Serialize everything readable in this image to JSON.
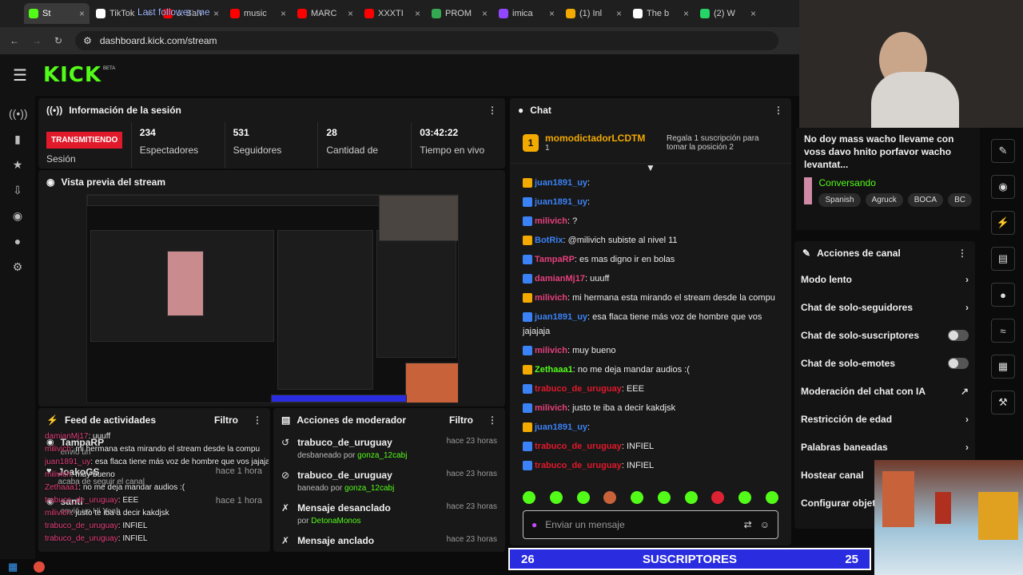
{
  "browser": {
    "tabs": [
      {
        "label": "St",
        "color": "#53fc18",
        "active": true
      },
      {
        "label": "TikTok",
        "color": "#ffffff"
      },
      {
        "label": "J. Balv",
        "color": "#ff0000"
      },
      {
        "label": "music",
        "color": "#ff0000"
      },
      {
        "label": "MARC",
        "color": "#ff0000"
      },
      {
        "label": "XXXTI",
        "color": "#ff0000"
      },
      {
        "label": "PROM",
        "color": "#34a853"
      },
      {
        "label": "imica",
        "color": "#9146ff"
      },
      {
        "label": "(1) Inl",
        "color": "#f2a900"
      },
      {
        "label": "The b",
        "color": "#ffffff"
      },
      {
        "label": "(2) W",
        "color": "#25d366"
      }
    ],
    "tab_overlay": "Last follower: me",
    "url": "dashboard.kick.com/stream"
  },
  "kick": {
    "logo": "KICK",
    "beta": "BETA"
  },
  "session": {
    "title": "Información de la sesión",
    "status": "TRANSMITIENDO",
    "status_label": "Sesión",
    "stats": [
      {
        "value": "234",
        "label": "Espectadores"
      },
      {
        "value": "531",
        "label": "Seguidores"
      },
      {
        "value": "28",
        "label": "Cantidad de"
      },
      {
        "value": "03:42:22",
        "label": "Tiempo en vivo"
      }
    ]
  },
  "preview": {
    "title": "Vista previa del stream"
  },
  "feed": {
    "title": "Feed de actividades",
    "filter": "Filtro",
    "items": [
      {
        "user": "TampaRP",
        "action": "envió un",
        "time": ""
      },
      {
        "user": "JoakoGS",
        "action": "acaba de seguir el canal",
        "time": "hace 1 hora"
      },
      {
        "user": "santi",
        "action": "envió un Hi Yeah",
        "time": "hace 1 hora"
      }
    ],
    "overlay_lines": [
      {
        "user": "damianMj17",
        "text": "uuuff"
      },
      {
        "user": "milivich",
        "text": "mi hermana esta mirando el stream desde la compu"
      },
      {
        "user": "juan1891_uy",
        "text": "esa flaca tiene más voz de hombre que vos jajajaja"
      },
      {
        "user": "milivich",
        "text": "muy bueno"
      },
      {
        "user": "Zethaaa1",
        "text": "no me deja mandar audios :("
      },
      {
        "user": "trabuco_de_uruguay",
        "text": "EEE"
      },
      {
        "user": "milivich",
        "text": "justo te iba a decir kakdjsk"
      },
      {
        "user": "trabuco_de_uruguay",
        "text": "INFIEL"
      },
      {
        "user": "trabuco_de_uruguay",
        "text": "INFIEL"
      }
    ]
  },
  "mod": {
    "title": "Acciones de moderador",
    "filter": "Filtro",
    "items": [
      {
        "title": "trabuco_de_uruguay",
        "sub": "desbaneado por",
        "by": "gonza_12cabj",
        "time": "hace 23 horas"
      },
      {
        "title": "trabuco_de_uruguay",
        "sub": "baneado por",
        "by": "gonza_12cabj",
        "time": "hace 23 horas"
      },
      {
        "title": "Mensaje desanclado",
        "sub": "por",
        "by": "DetonaMonos",
        "time": "hace 23 horas"
      },
      {
        "title": "Mensaje anclado",
        "sub": "",
        "by": "",
        "time": "hace 23 horas"
      }
    ]
  },
  "chat": {
    "title": "Chat",
    "pinned_user": "momodictadorLCDTM",
    "pinned_rank": "1",
    "pinned_count": "1",
    "pinned_cta": "Regala 1 suscripción para tomar la posición 2",
    "messages": [
      {
        "user": "juan1891_uy",
        "color": "#3b82f6",
        "text": ""
      },
      {
        "user": "juan1891_uy",
        "color": "#3b82f6",
        "text": ""
      },
      {
        "user": "milivich",
        "color": "#e4407b",
        "text": "?"
      },
      {
        "user": "BotRix",
        "color": "#3b82f6",
        "text": "@milivich subiste al nivel 11"
      },
      {
        "user": "TampaRP",
        "color": "#e4407b",
        "text": "es mas digno ir en bolas"
      },
      {
        "user": "damianMj17",
        "color": "#e4407b",
        "text": "uuuff"
      },
      {
        "user": "milivich",
        "color": "#e4407b",
        "text": "mi hermana esta mirando el stream desde la compu"
      },
      {
        "user": "juan1891_uy",
        "color": "#3b82f6",
        "text": "esa flaca tiene más voz de hombre que vos jajajaja"
      },
      {
        "user": "milivich",
        "color": "#e4407b",
        "text": "muy bueno"
      },
      {
        "user": "Zethaaa1",
        "color": "#53fc18",
        "text": "no me deja mandar audios :("
      },
      {
        "user": "trabuco_de_uruguay",
        "color": "#e0192b",
        "text": "EEE"
      },
      {
        "user": "milivich",
        "color": "#e4407b",
        "text": "justo te iba a decir kakdjsk"
      },
      {
        "user": "juan1891_uy",
        "color": "#3b82f6",
        "text": ""
      },
      {
        "user": "trabuco_de_uruguay",
        "color": "#e0192b",
        "text": "INFIEL"
      },
      {
        "user": "trabuco_de_uruguay",
        "color": "#e0192b",
        "text": "INFIEL"
      }
    ],
    "input_placeholder": "Enviar un mensaje"
  },
  "stream_info": {
    "title": "No doy mass wacho llevame con voss davo hnito porfavor wacho levantat...",
    "category": "Conversando",
    "tags": [
      "Spanish",
      "Agruck",
      "BOCA",
      "BC"
    ]
  },
  "channel_actions": {
    "title": "Acciones de canal",
    "items": [
      {
        "label": "Modo lento",
        "kind": "arrow"
      },
      {
        "label": "Chat de solo-seguidores",
        "kind": "arrow"
      },
      {
        "label": "Chat de solo-suscriptores",
        "kind": "toggle"
      },
      {
        "label": "Chat de solo-emotes",
        "kind": "toggle"
      },
      {
        "label": "Moderación del chat con IA",
        "kind": "external"
      },
      {
        "label": "Restricción de edad",
        "kind": "arrow"
      },
      {
        "label": "Palabras baneadas",
        "kind": "arrow"
      },
      {
        "label": "Hostear canal",
        "kind": "arrow"
      },
      {
        "label": "Configurar objeti",
        "kind": "none"
      }
    ]
  },
  "subs_bar": {
    "left": "26",
    "label": "SUSCRIPTORES",
    "right": "25"
  },
  "colors": {
    "kick_green": "#53fc18",
    "live_red": "#e0192b",
    "subs_blue": "#2a2ce0"
  }
}
